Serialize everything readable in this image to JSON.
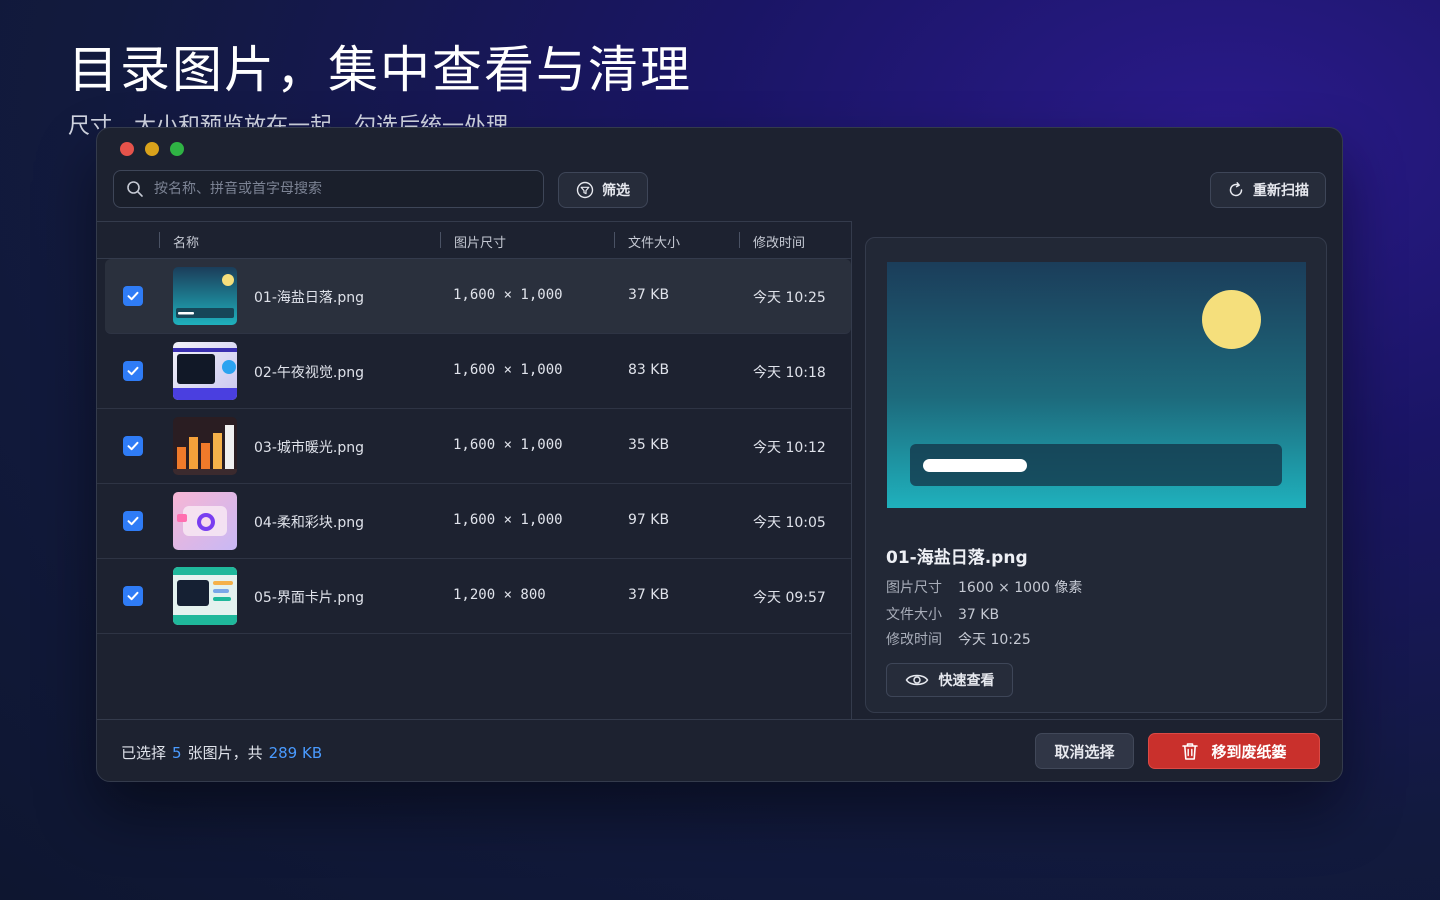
{
  "hero": {
    "title": "目录图片，集中查看与清理",
    "subtitle": "尺寸、大小和预览放在一起，勾选后统一处理"
  },
  "toolbar": {
    "search_placeholder": "按名称、拼音或首字母搜索",
    "filter_label": "筛选",
    "rescan_label": "重新扫描"
  },
  "table": {
    "headers": {
      "name": "名称",
      "dimensions": "图片尺寸",
      "size": "文件大小",
      "modified": "修改时间"
    },
    "rows": [
      {
        "name": "01-海盐日落.png",
        "dimensions": "1,600 × 1,000",
        "size": "37 KB",
        "modified": "今天 10:25",
        "checked": true,
        "thumb": "sunset"
      },
      {
        "name": "02-午夜视觉.png",
        "dimensions": "1,600 × 1,000",
        "size": "83 KB",
        "modified": "今天 10:18",
        "checked": true,
        "thumb": "midnight"
      },
      {
        "name": "03-城市暖光.png",
        "dimensions": "1,600 × 1,000",
        "size": "35 KB",
        "modified": "今天 10:12",
        "checked": true,
        "thumb": "city"
      },
      {
        "name": "04-柔和彩块.png",
        "dimensions": "1,600 × 1,000",
        "size": "97 KB",
        "modified": "今天 10:05",
        "checked": true,
        "thumb": "pastel"
      },
      {
        "name": "05-界面卡片.png",
        "dimensions": "1,200 × 800",
        "size": "37 KB",
        "modified": "今天 09:57",
        "checked": true,
        "thumb": "card"
      }
    ]
  },
  "preview": {
    "name": "01-海盐日落.png",
    "dim_label": "图片尺寸",
    "dim_value": "1600 × 1000 像素",
    "size_label": "文件大小",
    "size_value": "37 KB",
    "time_label": "修改时间",
    "time_value": "今天 10:25",
    "quick_look_label": "快速查看"
  },
  "footer": {
    "prefix": "已选择",
    "count": "5",
    "middle": "张图片，共",
    "total": "289 KB",
    "cancel_label": "取消选择",
    "trash_label": "移到废纸篓"
  },
  "colors": {
    "accent": "#2f7cf6",
    "highlight": "#4a9bff",
    "danger": "#c9302c"
  }
}
